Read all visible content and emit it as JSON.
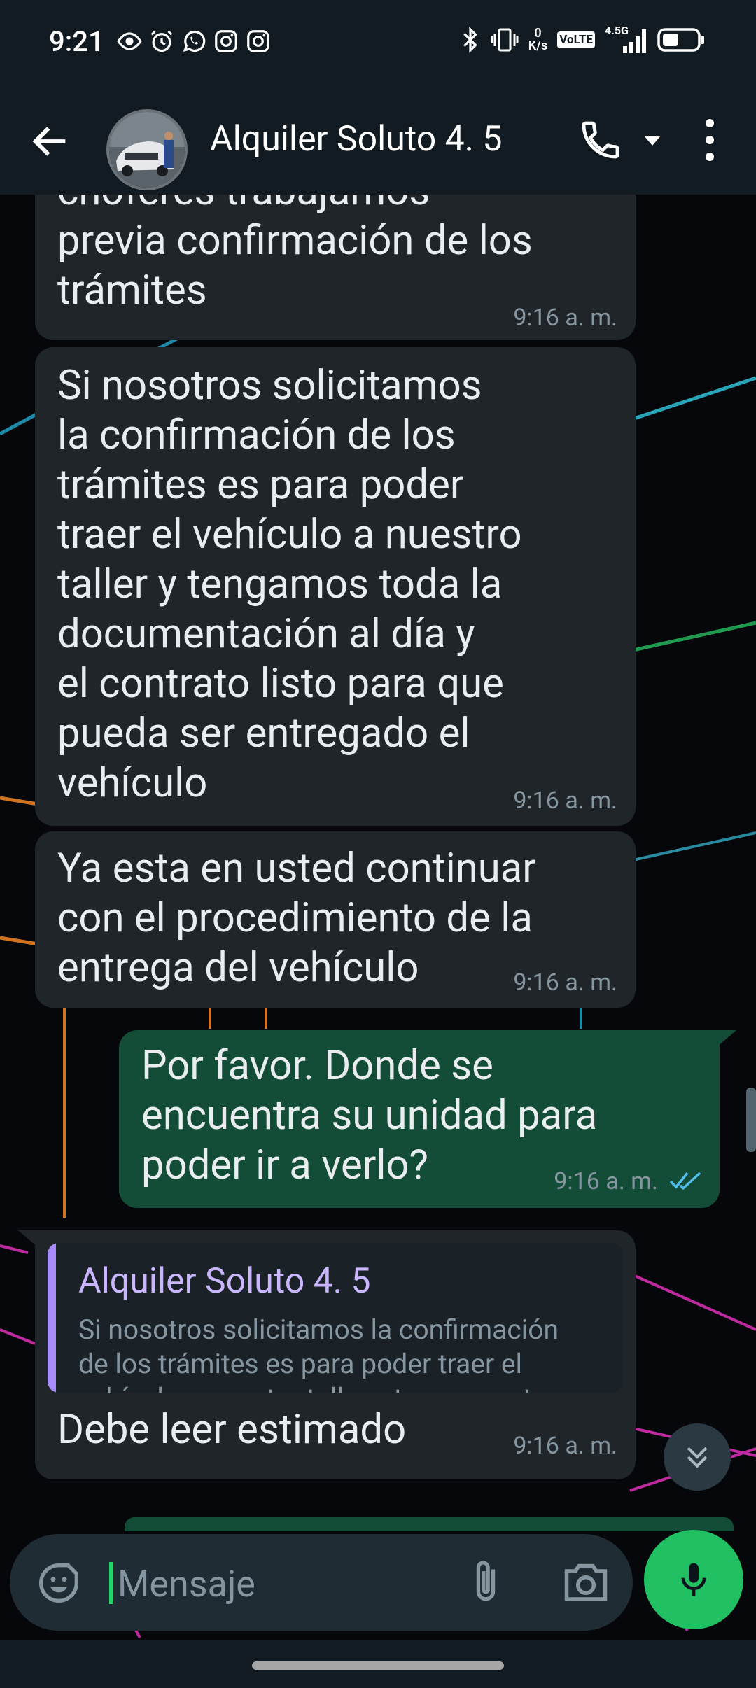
{
  "status_bar": {
    "time": "9:21",
    "net_speed_value": "0",
    "net_speed_unit": "K/s",
    "volte": "VoLTE",
    "network": "4.5G"
  },
  "header": {
    "contact_name": "Alquiler Soluto 4. 5"
  },
  "messages": [
    {
      "direction": "in",
      "text": "choferes trabajamos\nprevia confirmación de los\ntrámites",
      "time": "9:16 a. m."
    },
    {
      "direction": "in",
      "text": "Si nosotros solicitamos\nla confirmación de los\ntrámites es para poder\ntraer el vehículo a nuestro\ntaller y tengamos toda la\ndocumentación al día y\nel contrato listo para que\npueda ser entregado el\nvehículo",
      "time": "9:16 a. m."
    },
    {
      "direction": "in",
      "text": "Ya esta en usted continuar\ncon el procedimiento de la\nentrega del vehículo",
      "time": "9:16 a. m."
    },
    {
      "direction": "out",
      "text": "Por favor. Donde se\nencuentra su unidad para\npoder ir a verlo?",
      "time": "9:16 a. m.",
      "status": "read"
    },
    {
      "direction": "in",
      "quoted_name": "Alquiler Soluto 4. 5",
      "quoted_text": "Si nosotros solicitamos la confirmación\nde los trámites es para poder traer el\nvehículo a nuestro taller y tengamos t...",
      "text": "Debe leer estimado",
      "time": "9:16 a. m."
    }
  ],
  "composer": {
    "placeholder": "Mensaje"
  },
  "colors": {
    "header_bg": "#111b21",
    "incoming_bubble": "#202529",
    "outgoing_bubble": "#144d37",
    "accent_green": "#21c063",
    "read_ticks": "#53bdeb",
    "quote_accent": "#a78bfa"
  },
  "icons": [
    "eye-icon",
    "alarm-icon",
    "whatsapp-icon",
    "instagram-icon",
    "instagram-icon",
    "bluetooth-icon",
    "vibrate-icon",
    "battery-icon",
    "back-arrow-icon",
    "phone-icon",
    "chevron-down-icon",
    "more-vert-icon",
    "emoji-icon",
    "attach-icon",
    "camera-icon",
    "mic-icon",
    "double-chevron-down-icon"
  ]
}
